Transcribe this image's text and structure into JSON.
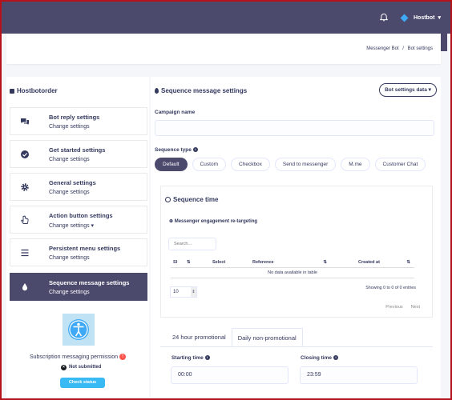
{
  "header": {
    "user_name": "Hostbot",
    "user_caret": "▾"
  },
  "breadcrumb": {
    "item1": "Messenger Bot",
    "separator": "/",
    "item2": "Bot settings"
  },
  "sidebar": {
    "title": "Hostbotorder",
    "items": [
      {
        "title": "Bot reply settings",
        "subtitle": "Change settings",
        "icon": "chat-bubbles-icon"
      },
      {
        "title": "Get started settings",
        "subtitle": "Change settings",
        "icon": "check-circle-icon"
      },
      {
        "title": "General settings",
        "subtitle": "Change settings",
        "icon": "gear-icon"
      },
      {
        "title": "Action button settings",
        "subtitle": "Change settings ▾",
        "icon": "pointer-hand-icon"
      },
      {
        "title": "Persistent menu settings",
        "subtitle": "Change settings",
        "icon": "menu-lines-icon"
      },
      {
        "title": "Sequence message settings",
        "subtitle": "Change settings",
        "icon": "droplet-icon",
        "active": true
      }
    ],
    "permission_label": "Subscription messaging permission",
    "permission_status": "Not submitted",
    "check_status_label": "Check status"
  },
  "main": {
    "title": "Sequence message settings",
    "data_button": "Bot settings data ▾",
    "campaign_label": "Campaign name",
    "campaign_value": "",
    "sequence_type_label": "Sequence type",
    "sequence_types": [
      "Default",
      "Custom",
      "Checkbox",
      "Send to messenger",
      "M.me",
      "Customer Chat"
    ],
    "sequence_time": {
      "title": "Sequence time",
      "subtitle": "Messenger engagement re-targeting",
      "search_placeholder": "Search...",
      "columns": [
        "Sl",
        "Select",
        "Reference",
        "Created at"
      ],
      "empty_text": "No data available in table",
      "page_length": "10",
      "entries_info": "Showing 0 to 0 of 0 entries",
      "prev": "Previous",
      "next": "Next"
    },
    "tabs": [
      "24 hour promotional",
      "Daily non-promotional"
    ],
    "active_tab": "Daily non-promotional",
    "starting_time_label": "Starting time",
    "starting_time": "00:00",
    "closing_time_label": "Closing time",
    "closing_time": "23:59"
  },
  "colors": {
    "topbar": "#4b4a6d",
    "accent": "#3abaf4",
    "danger": "#fc544b",
    "border": "#b5121b"
  }
}
